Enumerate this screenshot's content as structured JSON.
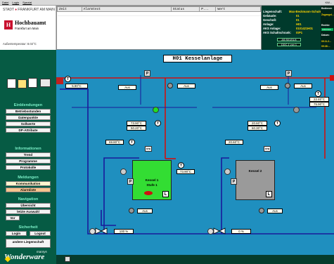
{
  "menubar": {
    "items": [
      "Datei",
      "Login",
      "Spezial"
    ],
    "clock": "KW..."
  },
  "logo": {
    "stadt_prefix": "STADT",
    "stadt_suffix": "FRANKFURT AM MAIN",
    "hb_glyph": "H",
    "hb_name": "Hochbauamt",
    "hb_sub": "Frankfurt am Main",
    "outside_label": "Außentemperatur:",
    "outside_value": "8.02°C"
  },
  "alarm_table": {
    "columns": [
      "Zeit",
      "Alarmtext",
      "Status",
      "P...",
      "Wert"
    ]
  },
  "info": {
    "rows": [
      {
        "label": "Liegenschaft:",
        "value": "Max-Beckmann-Schule"
      },
      {
        "label": "Gebäude:",
        "value": "01"
      },
      {
        "label": "Geschoß:",
        "value": "01"
      },
      {
        "label": "Anlage:",
        "value": "H01"
      },
      {
        "label": "AKS Anlage:",
        "value": "0101421H01"
      },
      {
        "label": "AKS Schaltschrank:",
        "value": "ISP1"
      }
    ],
    "btn1": "AS:S01/01/4",
    "btn2": "DDC-1 von 1"
  },
  "right_panel": {
    "title": "Bedienen",
    "sub": "Zugangsl...",
    "heading": "Rechte:",
    "badge": "Administr...",
    "date_label": "Datum:",
    "date_value": "09.11.2...",
    "time_value": "09:38:..."
  },
  "sidebar": {
    "heading_settings": "Einblendungen",
    "settings_items": [
      "Betriebsstunden",
      "Datenpunkte",
      "Sollwerte",
      "DP-Attribute"
    ],
    "heading_info": "Informationen",
    "info_items": [
      "Trend",
      "Programme",
      "Protokolle"
    ],
    "heading_msg": "Meldungen",
    "msg_items": [
      "Kommunikation",
      "Alarmliste"
    ],
    "heading_nav": "Navigation",
    "nav_items": [
      "Übersicht",
      "letzte Auswahl",
      "Vor"
    ],
    "heading_sec": "Sicherheit",
    "sec_items": [
      "Login",
      "Logout"
    ],
    "other_btn": "andere Liegenschaft",
    "brand_small": "manrys",
    "brand_large": "Wonderware"
  },
  "scheme": {
    "title": "H01 Kesselanlage",
    "outside_temp": "5.90°C",
    "aus_top1": "Aus",
    "aus_top2": "Aus",
    "aus_left": "Aus",
    "aus_right": "Aus",
    "temp_vl1": "73.90°C",
    "temp_vl1_set": "50.20°C",
    "temp_vl2": "20.60°C",
    "temp_vl2_set": "60.30°C",
    "temp_rl_left": "69.80°C",
    "temp_rl_right": "20.60°C",
    "temp_boiler1": "73.90°C",
    "temp_far_right": "22.40°C",
    "temp_far_right_set": "75.90°C",
    "kessel1_name": "Kessel 1",
    "kessel1_stage": "Stufe 1",
    "kessel2_name": "Kessel 2",
    "pump_aus1": "Aus",
    "pump_aus2": "Aus",
    "valve1": "100 %",
    "valve2": "0 %"
  },
  "colors": {
    "pipe_blue": "#1a1a9a",
    "pipe_red": "#d01010",
    "boiler_on": "#33dd33",
    "boiler_off": "#9a9a9a",
    "led_green": "#22dd22",
    "led_grey": "#999999"
  }
}
